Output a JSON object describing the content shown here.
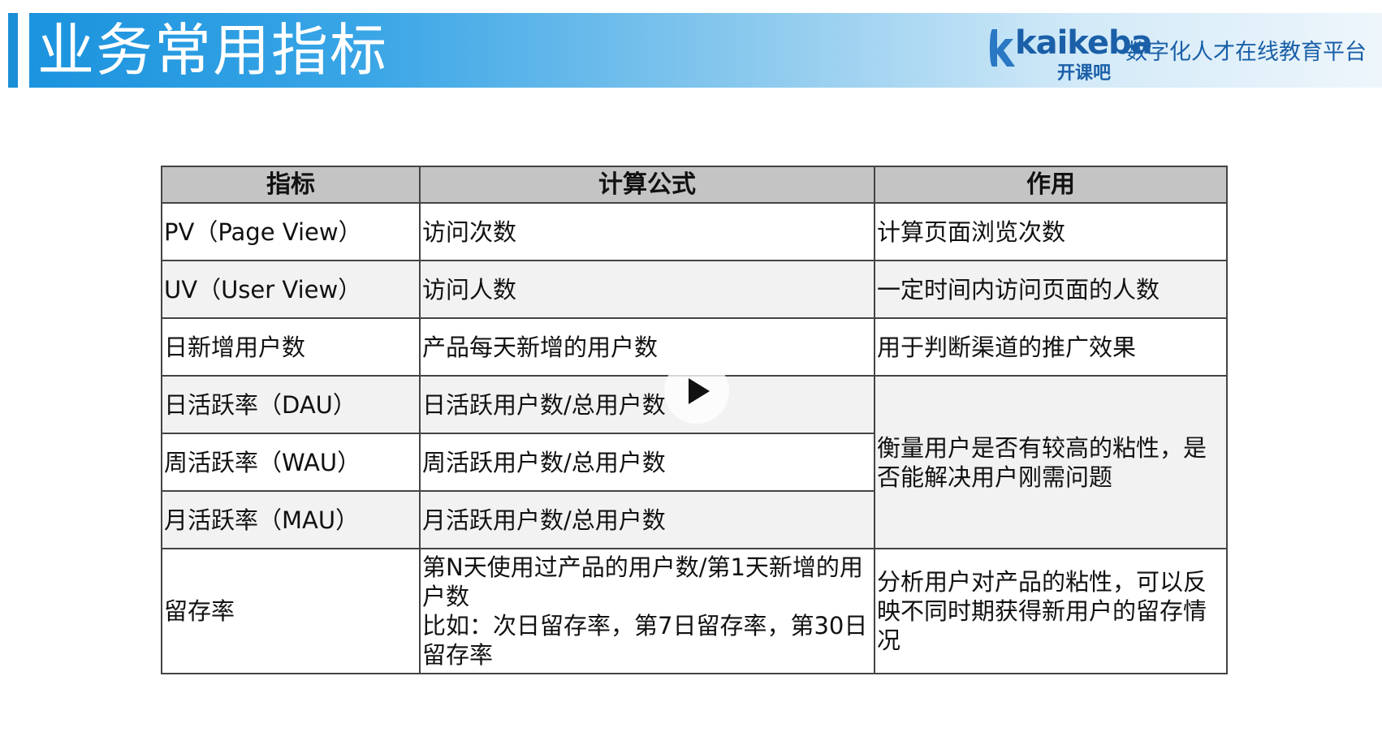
{
  "header": {
    "title": "业务常用指标",
    "brand": {
      "name": "kaikeba",
      "name_cn": "开课吧",
      "slogan": "数字化人才在线教育平台",
      "color": "#1a5fa8"
    },
    "accent_color": "#1a8fd6"
  },
  "table": {
    "headers": [
      "指标",
      "计算公式",
      "作用"
    ],
    "rows": [
      {
        "metric": "PV（Page View）",
        "formula": "访问次数",
        "purpose": "计算页面浏览次数"
      },
      {
        "metric": "UV（User View）",
        "formula": "访问人数",
        "purpose": "一定时间内访问页面的人数"
      },
      {
        "metric": "日新增用户数",
        "formula": "产品每天新增的用户数",
        "purpose": "用于判断渠道的推广效果"
      },
      {
        "metric": "日活跃率（DAU）",
        "formula": "日活跃用户数/总用户数"
      },
      {
        "metric": "周活跃率（WAU）",
        "formula": "周活跃用户数/总用户数"
      },
      {
        "metric": "月活跃率（MAU）",
        "formula": "月活跃用户数/总用户数"
      },
      {
        "metric": "留存率",
        "formula_line1": "第N天使用过产品的用户数/第1天新增的用户数",
        "formula_line2": "比如：次日留存率，第7日留存率，第30日留存率",
        "purpose": "分析用户对产品的粘性，可以反映不同时期获得新用户的留存情况"
      }
    ],
    "merged_purpose": "衡量用户是否有较高的粘性，是否能解决用户刚需问题"
  },
  "player": {
    "play_icon": "play-icon"
  }
}
